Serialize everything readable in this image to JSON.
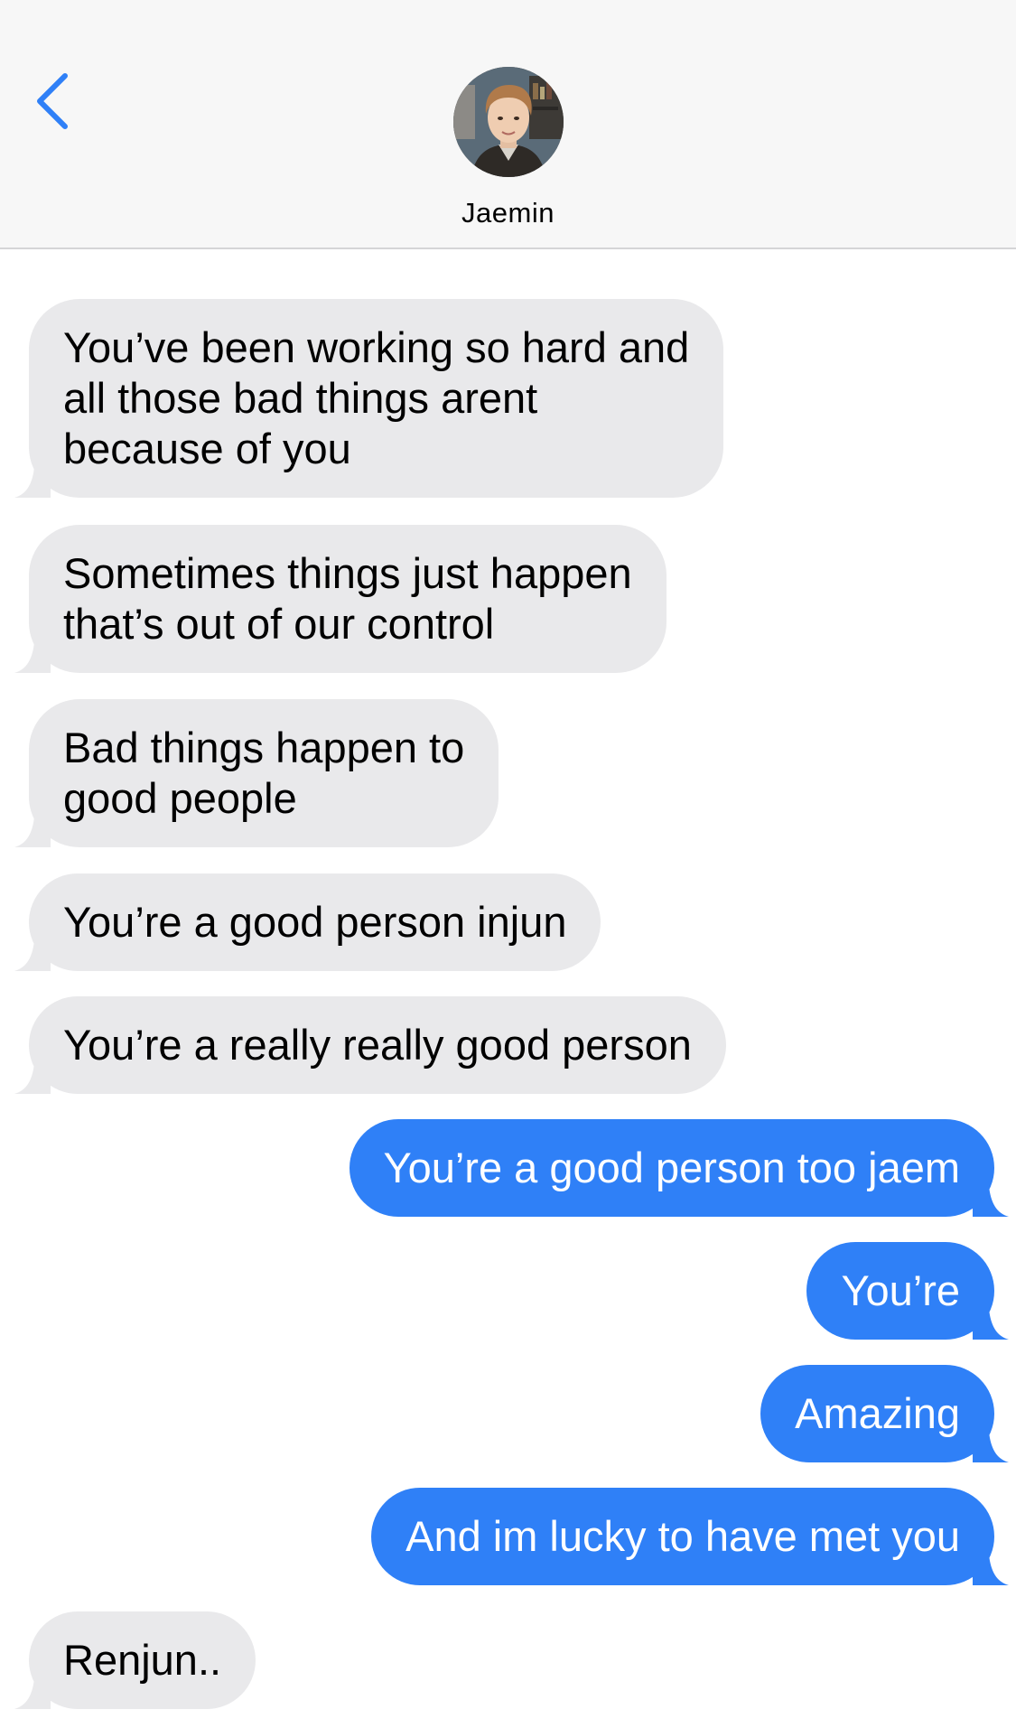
{
  "header": {
    "contact_name": "Jaemin",
    "back_icon": "chevron-left-icon",
    "accent_color": "#2f80f7"
  },
  "messages": [
    {
      "direction": "incoming",
      "lines": [
        "You’ve been working so hard and",
        "all those bad things arent",
        "because of you"
      ]
    },
    {
      "direction": "incoming",
      "lines": [
        "Sometimes things just happen",
        "that’s out of our control"
      ]
    },
    {
      "direction": "incoming",
      "lines": [
        "Bad things happen to",
        "good people"
      ]
    },
    {
      "direction": "incoming",
      "lines": [
        "You’re a good person injun"
      ]
    },
    {
      "direction": "incoming",
      "lines": [
        "You’re a really really good person"
      ]
    },
    {
      "direction": "outgoing",
      "lines": [
        "You’re a good person too jaem"
      ]
    },
    {
      "direction": "outgoing",
      "lines": [
        "You’re"
      ]
    },
    {
      "direction": "outgoing",
      "lines": [
        "Amazing"
      ]
    },
    {
      "direction": "outgoing",
      "lines": [
        "And im lucky to have met you"
      ]
    },
    {
      "direction": "incoming",
      "lines": [
        "Renjun.."
      ]
    }
  ],
  "colors": {
    "incoming_bubble": "#e9e9eb",
    "outgoing_bubble": "#2f80f7",
    "header_background": "#f7f7f7"
  }
}
